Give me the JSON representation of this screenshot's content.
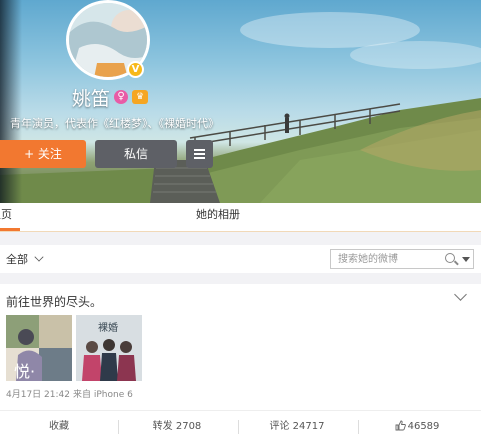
{
  "profile": {
    "name": "姚笛",
    "verified_badge": "V",
    "gender_icon": "female-icon",
    "intro": "青年演员，代表作《红楼梦》、《裸婚时代》"
  },
  "actions": {
    "follow_label": "+ 关注",
    "message_label": "私信",
    "more_icon": "menu-icon"
  },
  "tabs": [
    {
      "label": "主页"
    },
    {
      "label": "她的相册"
    }
  ],
  "filter": {
    "selected": "全部",
    "search_placeholder": "搜索她的微博"
  },
  "post": {
    "text": "前往世界的尽头。",
    "date": "4月17日 21:42",
    "source": "来自 iPhone 6",
    "thumb1_overlay": "悦·",
    "thumb2_overlay": "裸婚"
  },
  "post_actions": {
    "favorite": "收藏",
    "repost": "转发 2708",
    "comment": "评论 24717",
    "like": "46589"
  },
  "colors": {
    "accent_orange": "#f27830",
    "button_gray": "#5e6066",
    "verified_gold": "#f7b81a",
    "gender_pink": "#e85ca6"
  }
}
